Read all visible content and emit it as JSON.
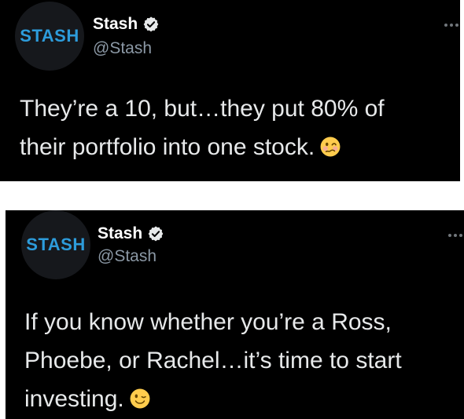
{
  "tweets": [
    {
      "logo": "STASH",
      "name": "Stash",
      "handle": "@Stash",
      "text": "They’re a 10, but…they put 80% of\ntheir portfolio into one stock.",
      "emoji_icon": "woozy-face-icon"
    },
    {
      "logo": "STASH",
      "name": "Stash",
      "handle": "@Stash",
      "text": "If you know whether you’re a Ross,\nPhoebe, or Rachel…it’s time to start\ninvesting.",
      "emoji_icon": "winking-face-icon"
    }
  ],
  "colors": {
    "background": "#000000",
    "brand": "#2d9cdb",
    "handle": "#8b98a5"
  }
}
